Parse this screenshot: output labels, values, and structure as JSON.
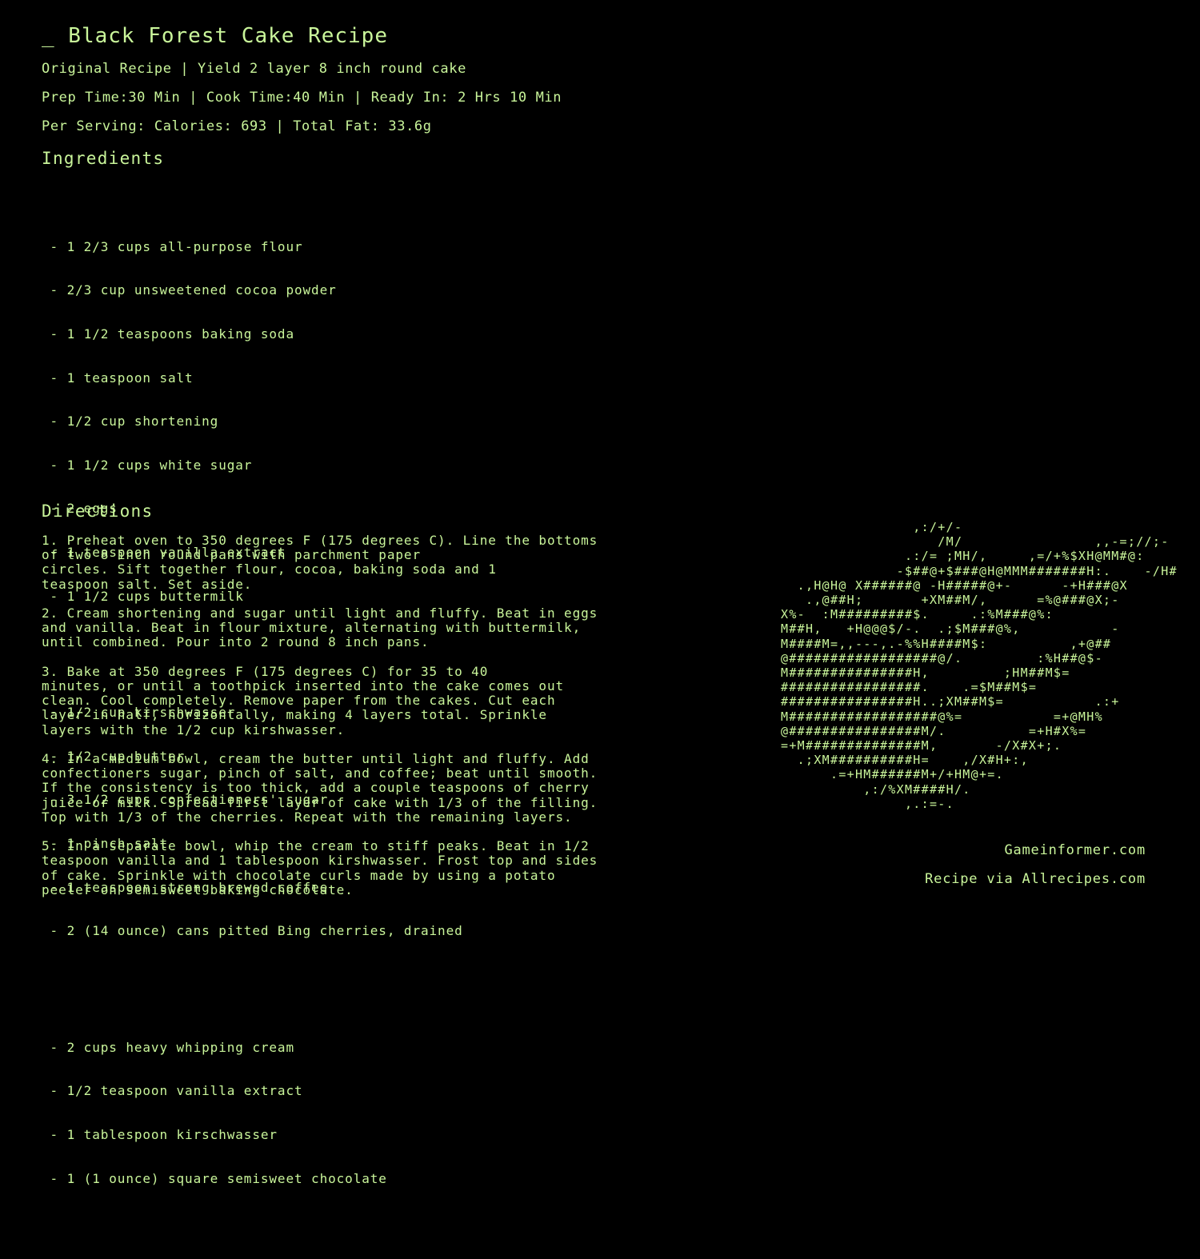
{
  "header": {
    "title": "_ Black Forest Cake Recipe",
    "meta_line_1": "Original Recipe | Yield 2 layer 8 inch round cake",
    "meta_line_2": "Prep Time:30 Min | Cook Time:40 Min | Ready In: 2 Hrs 10 Min",
    "meta_line_3": "Per Serving: Calories: 693 | Total Fat: 33.6g"
  },
  "ingredients": {
    "heading": "Ingredients",
    "groups": [
      [
        " - 1 2/3 cups all-purpose flour",
        " - 2/3 cup unsweetened cocoa powder",
        " - 1 1/2 teaspoons baking soda",
        " - 1 teaspoon salt",
        " - 1/2 cup shortening",
        " - 1 1/2 cups white sugar",
        " - 2 eggs",
        " - 1 teaspoon vanilla extract",
        " - 1 1/2 cups buttermilk"
      ],
      [
        " - 1/2 cup kirschwasser",
        " - 1/2 cup butter",
        " - 3 1/2 cups confectioners' sugar",
        " - 1 pinch salt",
        " - 1 teaspoon strong brewed coffee",
        " - 2 (14 ounce) cans pitted Bing cherries, drained"
      ],
      [
        " - 2 cups heavy whipping cream",
        " - 1/2 teaspoon vanilla extract",
        " - 1 tablespoon kirschwasser",
        " - 1 (1 ounce) square semisweet chocolate"
      ]
    ]
  },
  "directions": {
    "heading": "Directions",
    "steps": [
      "1. Preheat oven to 350 degrees F (175 degrees C). Line the bottoms\nof two 8 inch round pans with parchment paper\ncircles. Sift together flour, cocoa, baking soda and 1\nteaspoon salt. Set aside.",
      "2. Cream shortening and sugar until light and fluffy. Beat in eggs\nand vanilla. Beat in flour mixture, alternating with buttermilk,\nuntil combined. Pour into 2 round 8 inch pans.",
      "3. Bake at 350 degrees F (175 degrees C) for 35 to 40\nminutes, or until a toothpick inserted into the cake comes out\nclean. Cool completely. Remove paper from the cakes. Cut each\nlayer in half, horizontally, making 4 layers total. Sprinkle\nlayers with the 1/2 cup kirshwasser.",
      "4. In a medium bowl, cream the butter until light and fluffy. Add\nconfectioners sugar, pinch of salt, and coffee; beat until smooth.\nIf the consistency is too thick, add a couple teaspoons of cherry\njuice or milk. Spread first layer of cake with 1/3 of the filling.\nTop with 1/3 of the cherries. Repeat with the remaining layers.",
      "5. In a separate bowl, whip the cream to stiff peaks. Beat in 1/2\nteaspoon vanilla and 1 tablespoon kirshwasser. Frost top and sides\nof cake. Sprinkle with chocolate curls made by using a potato\npeeler on semisweet baking chocolate."
    ]
  },
  "ascii_art": "                ,:/+/-\n                   /M/                ,,-=;//;-\n               .:/= ;MH/,     ,=/+%$XH@MM#@:\n              -$##@+$###@H@MMM#######H:.    -/H#\n  .,H@H@ X######@ -H#####@+-      -+H###@X\n   .,@##H;       +XM##M/,      =%@###@X;-\nX%-  :M#########$.     .:%M###@%:\nM##H,   +H@@@$/-.  .;$M###@%,           -\nM####M=,,---,.-%%H####M$:          ,+@##\n@##################@/.         :%H##@$-\nM###############H,         ;HM##M$=\n#################.    .=$M##M$=\n################H..;XM##M$=           .:+\nM##################@%=           =+@MH%\n@################M/.          =+H#X%=\n=+M##############M,       -/X#X+;.\n  .;XM##########H=    ,/X#H+:,\n      .=+HM######M+/+HM@+=.\n          ,:/%XM####H/.\n               ,.:=-.",
  "footer": {
    "credit_1": "Gameinformer.com",
    "credit_2": "Recipe via Allrecipes.com"
  }
}
